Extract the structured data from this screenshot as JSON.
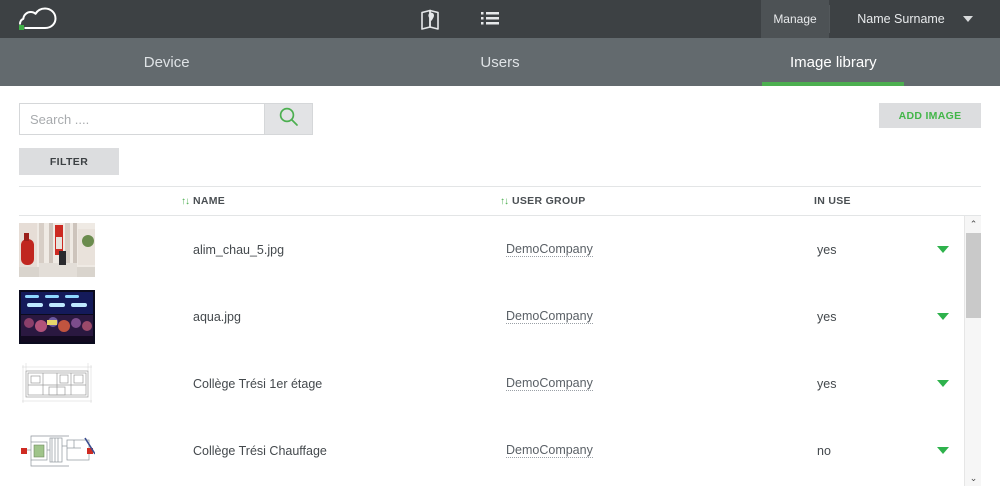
{
  "header": {
    "logo_name": "cloud-logo",
    "icons": [
      {
        "name": "map-book-icon",
        "label": "Map"
      },
      {
        "name": "list-icon",
        "label": "List"
      }
    ],
    "manage_label": "Manage",
    "user_label": "Name Surname"
  },
  "nav": {
    "tabs": [
      {
        "label": "Device",
        "active": false
      },
      {
        "label": "Users",
        "active": false
      },
      {
        "label": "Image library",
        "active": true
      }
    ],
    "accent_color": "#4caf50"
  },
  "toolbar": {
    "search_placeholder": "Search ....",
    "search_value": "",
    "search_button_icon": "search-icon",
    "filter_label": "FILTER",
    "add_image_label": "ADD IMAGE",
    "add_image_color": "#43b649"
  },
  "table": {
    "columns": [
      {
        "key": "name",
        "label": "NAME",
        "sortable": true,
        "sort_icon": "↑↓"
      },
      {
        "key": "user_group",
        "label": "USER GROUP",
        "sortable": true,
        "sort_icon": "↑↓"
      },
      {
        "key": "in_use",
        "label": "IN USE",
        "sortable": false
      }
    ],
    "rows": [
      {
        "thumbnail": "boiler-room-photo",
        "name": "alim_chau_5.jpg",
        "user_group": "DemoCompany",
        "in_use": "yes"
      },
      {
        "thumbnail": "aquarium-photo",
        "name": "aqua.jpg",
        "user_group": "DemoCompany",
        "in_use": "yes"
      },
      {
        "thumbnail": "floor-plan-drawing",
        "name": "Collège Trési 1er étage",
        "user_group": "DemoCompany",
        "in_use": "yes"
      },
      {
        "thumbnail": "heating-schematic-drawing",
        "name": "Collège Trési Chauffage",
        "user_group": "DemoCompany",
        "in_use": "no"
      }
    ]
  },
  "scrollbar": {
    "up_arrow": "⌃",
    "down_arrow": "⌄"
  }
}
